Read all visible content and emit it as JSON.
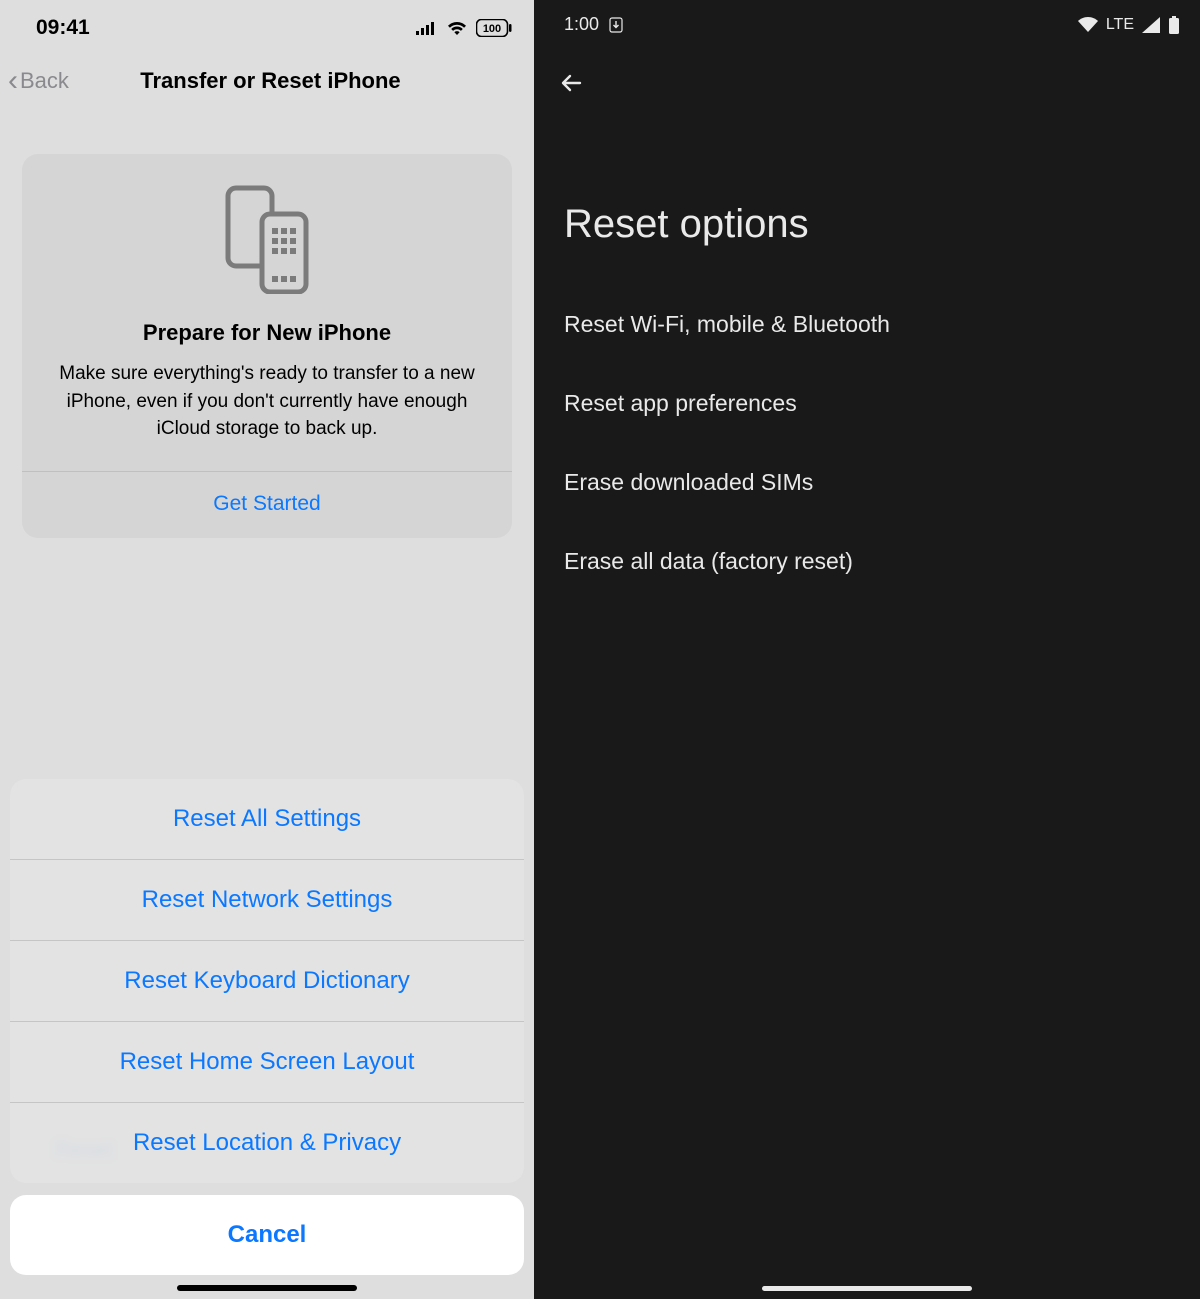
{
  "ios": {
    "status": {
      "time": "09:41",
      "battery": "100"
    },
    "nav": {
      "back": "Back",
      "title": "Transfer or Reset iPhone"
    },
    "card": {
      "heading": "Prepare for New iPhone",
      "body": "Make sure everything's ready to transfer to a new iPhone, even if you don't currently have enough iCloud storage to back up.",
      "cta": "Get Started"
    },
    "ghost": "Reset",
    "sheet": {
      "options": [
        "Reset All Settings",
        "Reset Network Settings",
        "Reset Keyboard Dictionary",
        "Reset Home Screen Layout",
        "Reset Location & Privacy"
      ],
      "cancel": "Cancel"
    }
  },
  "android": {
    "status": {
      "time": "1:00",
      "network": "LTE"
    },
    "title": "Reset options",
    "items": [
      "Reset Wi-Fi, mobile & Bluetooth",
      "Reset app preferences",
      "Erase downloaded SIMs",
      "Erase all data (factory reset)"
    ]
  }
}
